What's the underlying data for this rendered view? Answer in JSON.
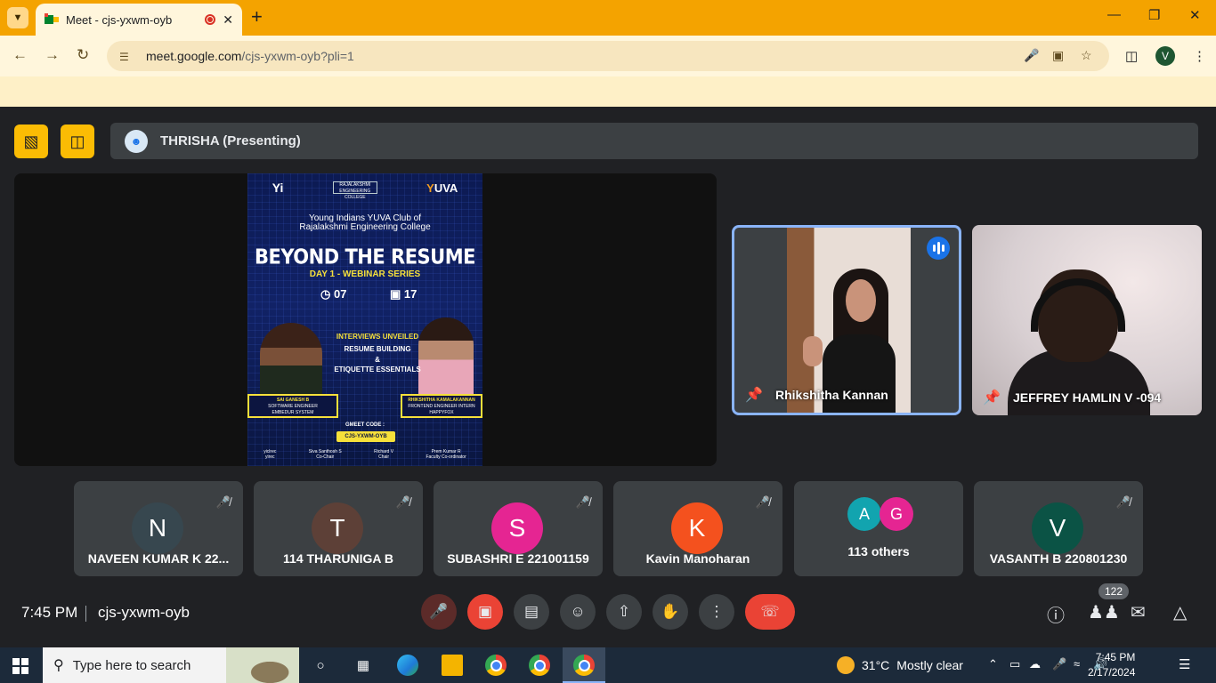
{
  "browser": {
    "tab_title": "Meet - cjs-yxwm-oyb",
    "url_host": "meet.google.com",
    "url_path": "/cjs-yxwm-oyb?pli=1",
    "profile_initial": "V"
  },
  "meet": {
    "presenter_label": "THRISHA (Presenting)",
    "poster": {
      "logo_left": "Yi",
      "logo_center": "RAJALAKSHMI ENGINEERING COLLEGE",
      "logo_right": "YUVA",
      "club_line1": "Young Indians YUVA Club of",
      "club_line2": "Rajalakshmi Engineering College",
      "title": "BEYOND THE RESUME",
      "day": "DAY 1 - WEBINAR SERIES",
      "time": "07",
      "date": "17",
      "section": "INTERVIEWS UNVEILED",
      "sub1": "RESUME BUILDING",
      "sub2": "&",
      "sub3": "ETIQUETTE ESSENTIALS",
      "speaker_left_name": "SAI GANESH B",
      "speaker_left_role": "SOFTWARE ENGINEER",
      "speaker_left_org": "EMBEDUR SYSTEM",
      "speaker_right_name": "RHIKSHITHA KAMALAKANNAN",
      "speaker_right_role": "FRONTEND ENGINEER INTERN",
      "speaker_right_org": "HAPPYFOX",
      "gmeet_label": "GMEET CODE :",
      "gmeet_code": "CJS-YXWM-OYB",
      "footer": [
        {
          "name": "yiclrec",
          "role": "yirec"
        },
        {
          "name": "Siva Santhosh S",
          "role": "Co-Chair"
        },
        {
          "name": "Richard V",
          "role": "Chair"
        },
        {
          "name": "Prem Kumar R",
          "role": "Faculty Co-ordinator"
        }
      ]
    },
    "video_tiles": [
      {
        "name": "Rhikshitha Kannan",
        "speaking": true
      },
      {
        "name": "JEFFREY HAMLIN V -094",
        "speaking": false
      }
    ],
    "participants": [
      {
        "initial": "N",
        "name": "NAVEEN KUMAR K 22...",
        "color": "#37474f"
      },
      {
        "initial": "T",
        "name": "114 THARUNIGA B",
        "color": "#5d4037"
      },
      {
        "initial": "S",
        "name": "SUBASHRI E 221001159",
        "color": "#e52592"
      },
      {
        "initial": "K",
        "name": "Kavin Manoharan",
        "color": "#f4511e"
      },
      {
        "initial": "V",
        "name": "VASANTH B 220801230",
        "color": "#0b5345"
      }
    ],
    "others": {
      "initials": [
        "A",
        "G"
      ],
      "colors": [
        "#12a4af",
        "#e52592"
      ],
      "label": "113 others"
    },
    "time": "7:45 PM",
    "meeting_code": "cjs-yxwm-oyb",
    "participant_count": "122"
  },
  "taskbar": {
    "search_placeholder": "Type here to search",
    "weather_temp": "31°C",
    "weather_text": "Mostly clear",
    "clock_time": "7:45 PM",
    "clock_date": "2/17/2024"
  }
}
